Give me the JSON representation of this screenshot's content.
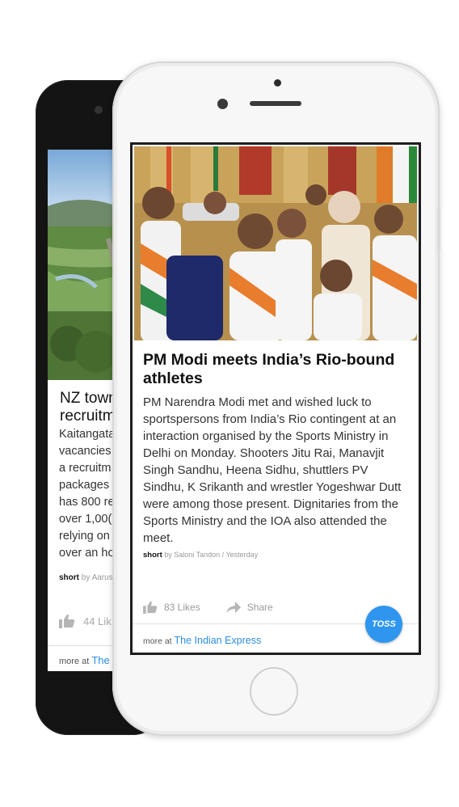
{
  "back_card": {
    "title": "NZ town\nrecruitm",
    "body": "Kaitangata\nvacancies\na recruitm\npackages\nhas 800 re\nover 1,00(\nrelying on\nover an ho",
    "byline_source": "short",
    "byline_rest": "by Aarus",
    "likes": "44 Lik",
    "more_prefix": "more at",
    "more_source": "The"
  },
  "front_card": {
    "headline": "PM Modi meets India’s Rio-bound athletes",
    "summary": "PM Narendra Modi met and wished luck to sportspersons from India’s Rio contingent at an interaction organised by the Sports Ministry in Delhi on Monday. Shooters Jitu Rai, Manavjit Singh Sandhu, Heena Sidhu, shuttlers PV Sindhu, K Srikanth and wrestler Yogeshwar Dutt were among those present. Dignitaries from the Sports Ministry and the IOA also attended the meet.",
    "byline_source": "short",
    "byline_rest": "by Saloni Tandon / Yesterday",
    "likes": "83 Likes",
    "share": "Share",
    "more_prefix": "more at",
    "more_source": "The Indian Express",
    "toss_label": "TOSS"
  },
  "colors": {
    "link_blue": "#2b8de4",
    "toss_blue": "#2e96ef",
    "back_phone": "#141414",
    "front_phone": "#f7f7f7"
  },
  "icons": [
    "thumbs-up-icon",
    "share-arrow-icon"
  ]
}
